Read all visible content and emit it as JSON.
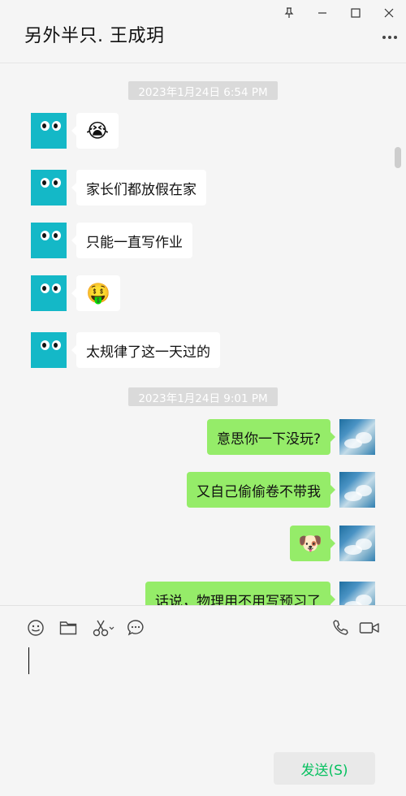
{
  "window": {
    "title": "另外半只. 王成玥",
    "controls": [
      "pin-icon",
      "minimize-icon",
      "maximize-icon",
      "close-icon"
    ],
    "more_icon": "more-icon"
  },
  "messages": {
    "ts1": "2023年1月24日 6:54 PM",
    "in1": "😭",
    "in2": "家长们都放假在家",
    "in3": "只能一直写作业",
    "in4": "🤑",
    "in5": "太规律了这一天过的",
    "ts2": "2023年1月24日 9:01 PM",
    "out1": "意思你一下没玩?",
    "out2": "又自己偷偷卷不带我",
    "out3": "🐶",
    "out4": "话说，物理用不用写预习了"
  },
  "toolbar": {
    "icons": [
      "emoji-icon",
      "folder-icon",
      "scissors-icon",
      "chat-history-icon",
      "phone-icon",
      "video-icon"
    ]
  },
  "input": {
    "value": ""
  },
  "send_button": {
    "label": "发送(S)"
  },
  "colors": {
    "background": "#f5f5f5",
    "outgoing_bubble": "#95ec69",
    "incoming_bubble": "#ffffff",
    "send_text": "#07c160",
    "avatar_teal": "#14b8c7"
  }
}
